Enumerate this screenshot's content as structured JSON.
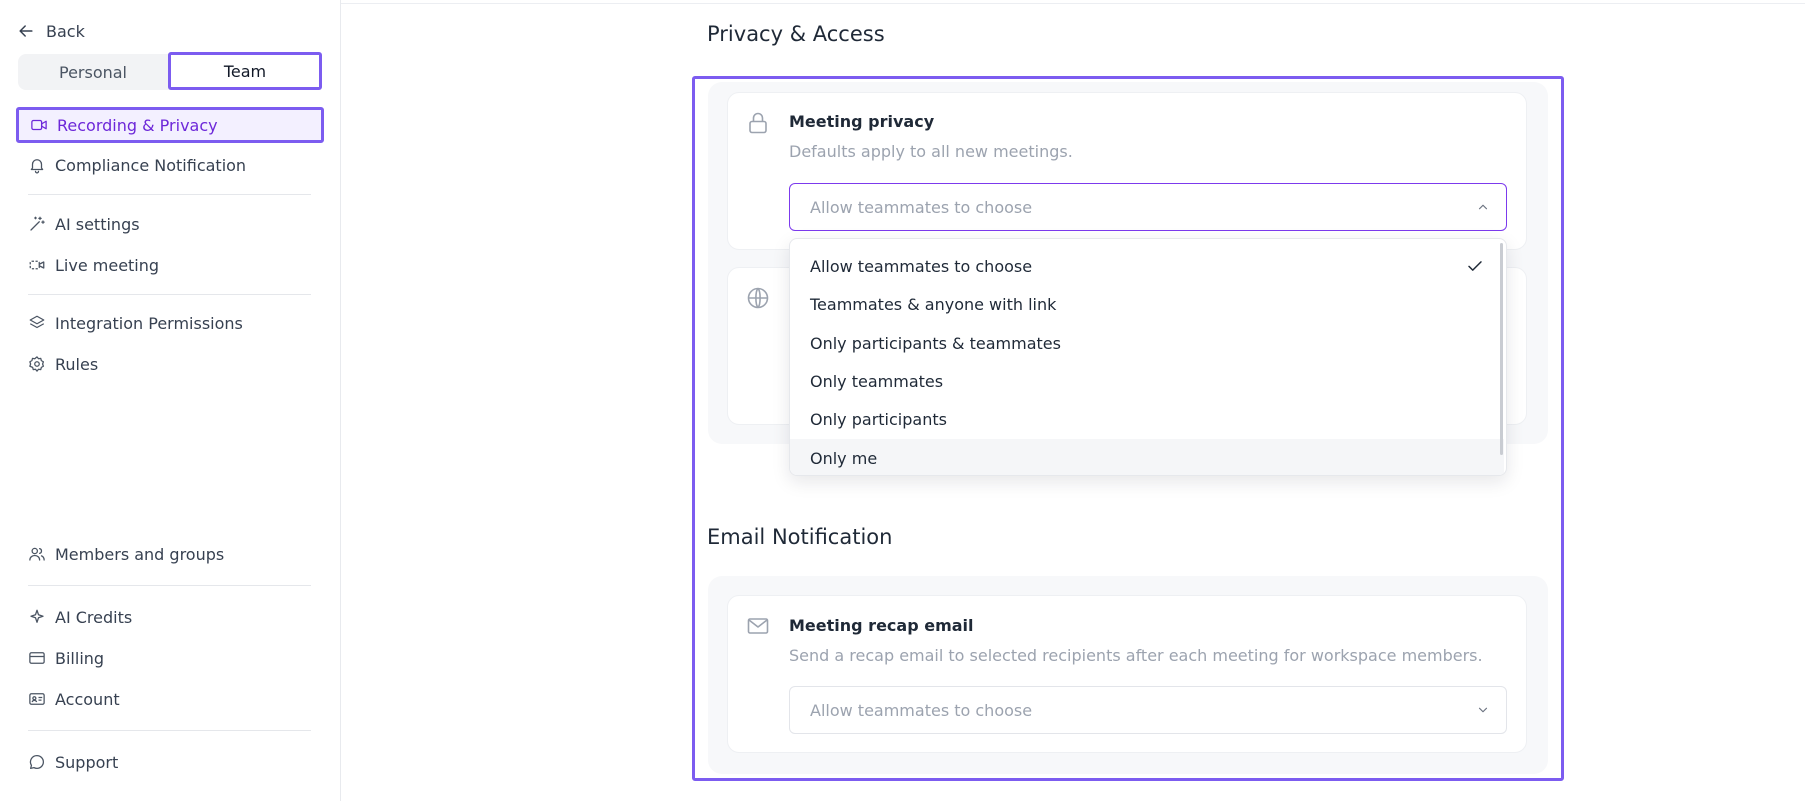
{
  "sidebar": {
    "back_label": "Back",
    "segments": {
      "personal": "Personal",
      "team": "Team",
      "selected": "Team"
    },
    "nav": {
      "recording": "Recording & Privacy",
      "compliance": "Compliance Notification",
      "ai_settings": "AI settings",
      "live_meeting": "Live meeting",
      "integration": "Integration Permissions",
      "rules": "Rules",
      "members": "Members and groups",
      "ai_credits": "AI Credits",
      "billing": "Billing",
      "account": "Account",
      "support": "Support"
    },
    "active_item": "Recording & Privacy"
  },
  "main": {
    "privacy_section": {
      "title": "Privacy & Access",
      "meeting_privacy": {
        "title": "Meeting privacy",
        "description": "Defaults apply to all new meetings.",
        "select_value": "Allow teammates to choose",
        "dropdown_open": true,
        "options": [
          "Allow teammates to choose",
          "Teammates & anyone with link",
          "Only participants & teammates",
          "Only teammates",
          "Only participants",
          "Only me"
        ],
        "selected_option": "Allow teammates to choose"
      }
    },
    "email_section": {
      "title": "Email Notification",
      "recap": {
        "title": "Meeting recap email",
        "description": "Send a recap email to selected recipients after each meeting for workspace members.",
        "select_value": "Allow teammates to choose"
      }
    }
  },
  "colors": {
    "accent": "#7c5cf0",
    "active_text": "#6d28d9",
    "active_bg": "#f3f0ff",
    "muted_text": "#9ca3af"
  },
  "icons": {
    "back": "arrow-left-icon",
    "recording": "video-camera-icon",
    "compliance": "bell-icon",
    "ai_settings": "magic-wand-icon",
    "live_meeting": "camera-icon",
    "integration": "layers-icon",
    "rules": "gear-icon",
    "members": "users-icon",
    "ai_credits": "sparkle-icon",
    "billing": "credit-card-icon",
    "account": "id-card-icon",
    "support": "chat-bubble-icon",
    "meeting_privacy": "lock-icon",
    "link_access": "globe-icon",
    "recap_email": "mail-icon"
  }
}
